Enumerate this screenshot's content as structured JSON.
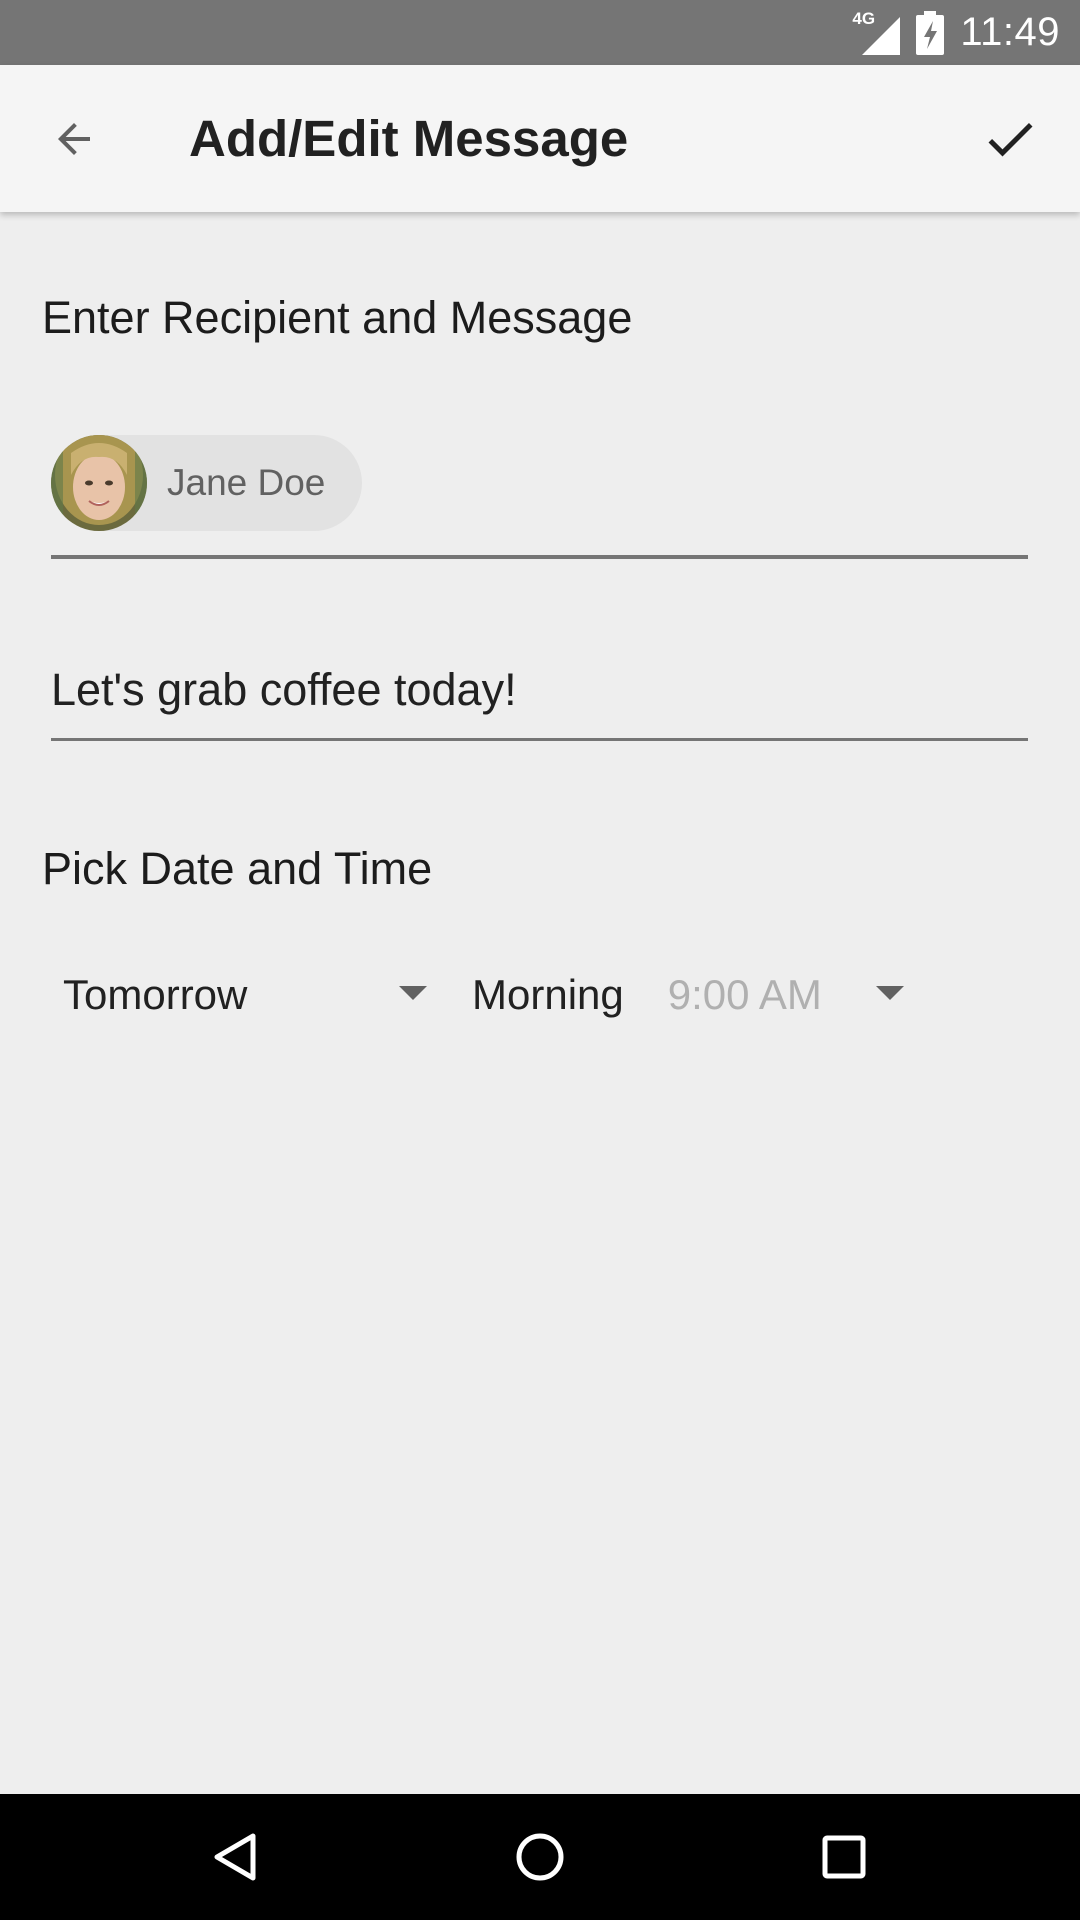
{
  "status_bar": {
    "network_label": "4G",
    "time": "11:49",
    "icons": [
      "signal-icon",
      "battery-charging-icon"
    ]
  },
  "app_bar": {
    "title": "Add/Edit Message",
    "back_icon": "arrow-back-icon",
    "done_icon": "check-icon"
  },
  "recipient_section": {
    "heading": "Enter Recipient and Message",
    "recipient_chip": {
      "name": "Jane Doe",
      "avatar": "contact-photo"
    },
    "message_value": "Let's grab coffee today!"
  },
  "schedule_section": {
    "heading": "Pick Date and Time",
    "day_spinner": {
      "selected": "Tomorrow"
    },
    "time_spinner": {
      "selected": "Morning",
      "detail": "9:00 AM"
    }
  },
  "nav_bar": {
    "icons": [
      "nav-back-icon",
      "nav-home-icon",
      "nav-recents-icon"
    ]
  },
  "colors": {
    "background": "#eeeeee",
    "app_bar": "#f5f5f5",
    "status_bar": "#757575",
    "nav_bar": "#000000",
    "text_primary": "#212121",
    "text_hint": "#b0b0b0"
  }
}
